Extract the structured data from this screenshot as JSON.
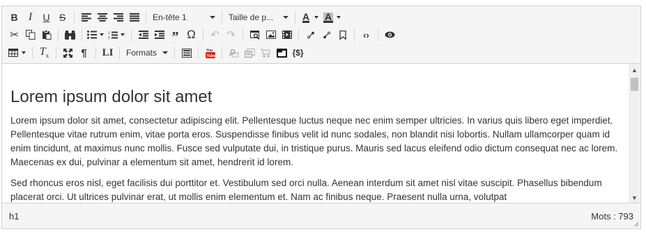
{
  "toolbar": {
    "heading_select": "En-tête 1",
    "font_size_select": "Taille de p...",
    "formats_menu": "Formats",
    "format_letters": {
      "bold": "B",
      "italic": "I",
      "underline": "U",
      "strike": "S",
      "text_color": "A",
      "background_color": "A",
      "omega": "Ω",
      "code": "‹›",
      "template_vars": "{$}"
    }
  },
  "document": {
    "heading": "Lorem ipsum dolor sit amet",
    "paragraphs": [
      "Lorem ipsum dolor sit amet, consectetur adipiscing elit. Pellentesque luctus neque nec enim semper ultricies. In varius quis libero eget imperdiet. Pellentesque vitae rutrum enim, vitae porta eros. Suspendisse finibus velit id nunc sodales, non blandit nisi lobortis. Nullam ullamcorper quam id enim tincidunt, at maximus nunc mollis. Fusce sed vulputate dui, in tristique purus. Mauris sed lacus eleifend odio dictum consequat nec ac lorem. Maecenas ex dui, pulvinar a elementum sit amet, hendrerit id lorem.",
      "Sed rhoncus eros nisl, eget facilisis dui porttitor et. Vestibulum sed orci nulla. Aenean interdum sit amet nisl vitae suscipit. Phasellus bibendum placerat orci. Ut ultrices pulvinar erat, ut mollis enim elementum et. Nam ac finibus neque. Praesent nulla urna, volutpat"
    ]
  },
  "status": {
    "element_path": "h1",
    "word_count": "Mots : 793"
  },
  "colors": {
    "toolbar_bg": "#f5f5f5",
    "border": "#d1d1d1",
    "text": "#333333",
    "disabled": "#bbbbbb",
    "youtube_red": "#e62117"
  }
}
